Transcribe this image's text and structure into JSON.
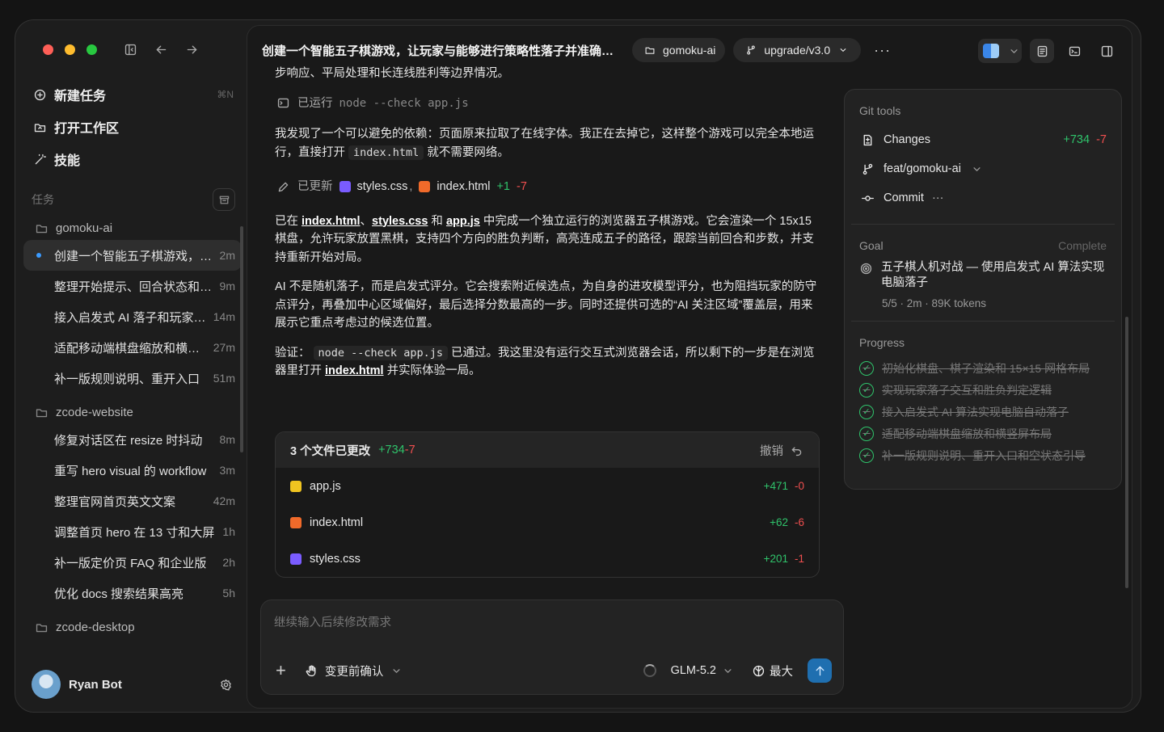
{
  "sidebar": {
    "nav": [
      {
        "label": "新建任务",
        "shortcut": "⌘N",
        "icon": "new-task-icon"
      },
      {
        "label": "打开工作区",
        "icon": "folder-open-icon"
      },
      {
        "label": "技能",
        "icon": "magic-wand-icon"
      }
    ],
    "section_title": "任务",
    "groups": [
      {
        "name": "gomoku-ai",
        "tasks": [
          {
            "name": "创建一个智能五子棋游戏，让玩家与能够进行策略性落子",
            "time": "2m"
          },
          {
            "name": "整理开始提示、回合状态和胜负提示",
            "time": "9m"
          },
          {
            "name": "接入启发式 AI 落子和玩家对战",
            "time": "14m"
          },
          {
            "name": "适配移动端棋盘缩放和横竖屏",
            "time": "27m"
          },
          {
            "name": "补一版规则说明、重开入口",
            "time": "51m"
          }
        ]
      },
      {
        "name": "zcode-website",
        "tasks": [
          {
            "name": "修复对话区在 resize 时抖动",
            "time": "8m"
          },
          {
            "name": "重写 hero visual 的 workflow",
            "time": "3m"
          },
          {
            "name": "整理官网首页英文文案",
            "time": "42m"
          },
          {
            "name": "调整首页 hero 在 13 寸和大屏",
            "time": "1h"
          },
          {
            "name": "补一版定价页 FAQ 和企业版",
            "time": "2h"
          },
          {
            "name": "优化 docs 搜索结果高亮",
            "time": "5h"
          }
        ]
      },
      {
        "name": "zcode-desktop",
        "tasks": []
      }
    ],
    "user": {
      "name": "Ryan Bot"
    }
  },
  "topbar": {
    "title": "创建一个智能五子棋游戏，让玩家与能够进行策略性落子并准确判断胜负的AI对战",
    "project_chip": "gomoku-ai",
    "branch_chip": "upgrade/v3.0",
    "more": "···"
  },
  "chat": {
    "intro": "步响应、平局处理和长连线胜利等边界情况。",
    "ran_label": "已运行",
    "ran_cmd": "node --check app.js",
    "p1a": "我发现了一个可以避免的依赖：页面原来拉取了在线字体。我正在去掉它，这样整个游戏可以完全本地运行，直接打开",
    "p1code": "index.html",
    "p1b": "就不需要网络。",
    "updated_label": "已更新",
    "updated_file1": "styles.css",
    "updated_sep": ",",
    "updated_file2": "index.html",
    "updated_add": "+1",
    "updated_del": "-7",
    "p2a": "已在",
    "p2l1": "index.html",
    "p2s1": "、",
    "p2l2": "styles.css",
    "p2s2": "和",
    "p2l3": "app.js",
    "p2b": "中完成一个独立运行的浏览器五子棋游戏。它会渲染一个 15x15 棋盘，允许玩家放置黑棋，支持四个方向的胜负判断，高亮连成五子的路径，跟踪当前回合和步数，并支持重新开始对局。",
    "p3": "AI 不是随机落子，而是启发式评分。它会搜索附近候选点，为自身的进攻模型评分，也为阻挡玩家的防守点评分，再叠加中心区域偏好，最后选择分数最高的一步。同时还提供可选的“AI 关注区域”覆盖层，用来展示它重点考虑过的候选位置。",
    "p4a": "验证：",
    "p4code": "node --check app.js",
    "p4b": "已通过。我这里没有运行交互式浏览器会话，所以剩下的一步是在浏览器里打开",
    "p4link": "index.html",
    "p4c": "并实际体验一局。"
  },
  "changes": {
    "title": "3 个文件已更改",
    "add": "+734",
    "del": "-7",
    "undo": "撤销",
    "files": [
      {
        "name": "app.js",
        "add": "+471",
        "del": "-0",
        "kind": "js"
      },
      {
        "name": "index.html",
        "add": "+62",
        "del": "-6",
        "kind": "html"
      },
      {
        "name": "styles.css",
        "add": "+201",
        "del": "-1",
        "kind": "css"
      }
    ]
  },
  "composer": {
    "placeholder": "继续输入后续修改需求",
    "plus": "+",
    "confirm_label": "变更前确认",
    "model": "GLM-5.2",
    "effort": "最大"
  },
  "panel": {
    "git_title": "Git tools",
    "changes_label": "Changes",
    "changes_add": "+734",
    "changes_del": "-7",
    "branch": "feat/gomoku-ai",
    "commit_label": "Commit",
    "commit_more": "···",
    "goal_title": "Goal",
    "goal_status": "Complete",
    "goal_text": "五子棋人机对战 — 使用启发式 AI 算法实现电脑落子",
    "goal_meta": "5/5 · 2m · 89K tokens",
    "progress_title": "Progress",
    "progress": [
      "初始化棋盘、棋子渲染和 15×15 网格布局",
      "实现玩家落子交互和胜负判定逻辑",
      "接入启发式 AI 算法实现电脑自动落子",
      "适配移动端棋盘缩放和横竖屏布局",
      "补一版规则说明、重开入口和空状态引导"
    ]
  },
  "colors": {
    "added": "#2fc36b",
    "deleted": "#f04f4f",
    "accent": "#3b9bff",
    "send": "#1f6fb0"
  }
}
